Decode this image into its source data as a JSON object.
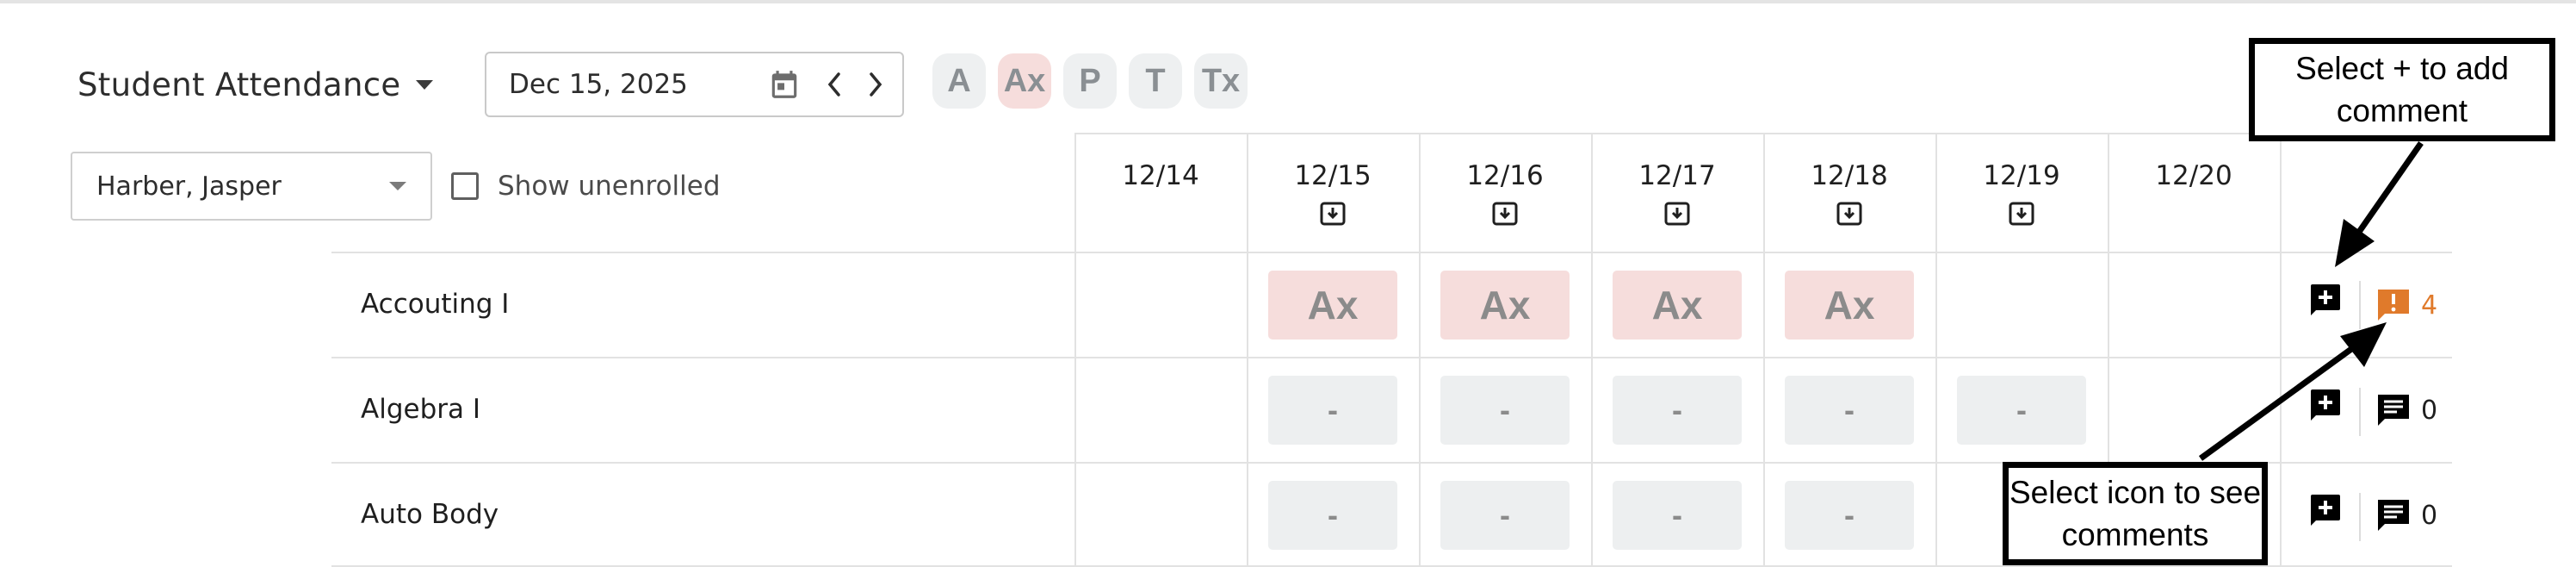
{
  "header": {
    "title": "Student Attendance",
    "date_value": "Dec 15, 2025",
    "codes": [
      {
        "label": "A",
        "active": false
      },
      {
        "label": "Ax",
        "active": true
      },
      {
        "label": "P",
        "active": false
      },
      {
        "label": "T",
        "active": false
      },
      {
        "label": "Tx",
        "active": false
      }
    ]
  },
  "filters": {
    "student": "Harber, Jasper",
    "show_unenrolled_label": "Show unenrolled",
    "show_unenrolled_checked": false
  },
  "dates": [
    {
      "label": "12/14",
      "download": false
    },
    {
      "label": "12/15",
      "download": true
    },
    {
      "label": "12/16",
      "download": true
    },
    {
      "label": "12/17",
      "download": true
    },
    {
      "label": "12/18",
      "download": true
    },
    {
      "label": "12/19",
      "download": true
    },
    {
      "label": "12/20",
      "download": false
    }
  ],
  "rows": [
    {
      "course": "Accouting I",
      "cells": [
        "",
        "Ax",
        "Ax",
        "Ax",
        "Ax",
        "",
        ""
      ],
      "comment_count": "4",
      "comment_alert": true
    },
    {
      "course": "Algebra I",
      "cells": [
        "",
        "-",
        "-",
        "-",
        "-",
        "-",
        ""
      ],
      "comment_count": "0",
      "comment_alert": false
    },
    {
      "course": "Auto Body",
      "cells": [
        "",
        "-",
        "-",
        "-",
        "-",
        "",
        ""
      ],
      "comment_count": "0",
      "comment_alert": false
    }
  ],
  "annotations": {
    "add_comment": "Select + to add comment",
    "see_comments": "Select icon to see comments"
  },
  "colors": {
    "absent_excused_bg": "#f6dddc",
    "empty_cell_bg": "#edeff0",
    "alert_orange": "#e07a2b"
  }
}
